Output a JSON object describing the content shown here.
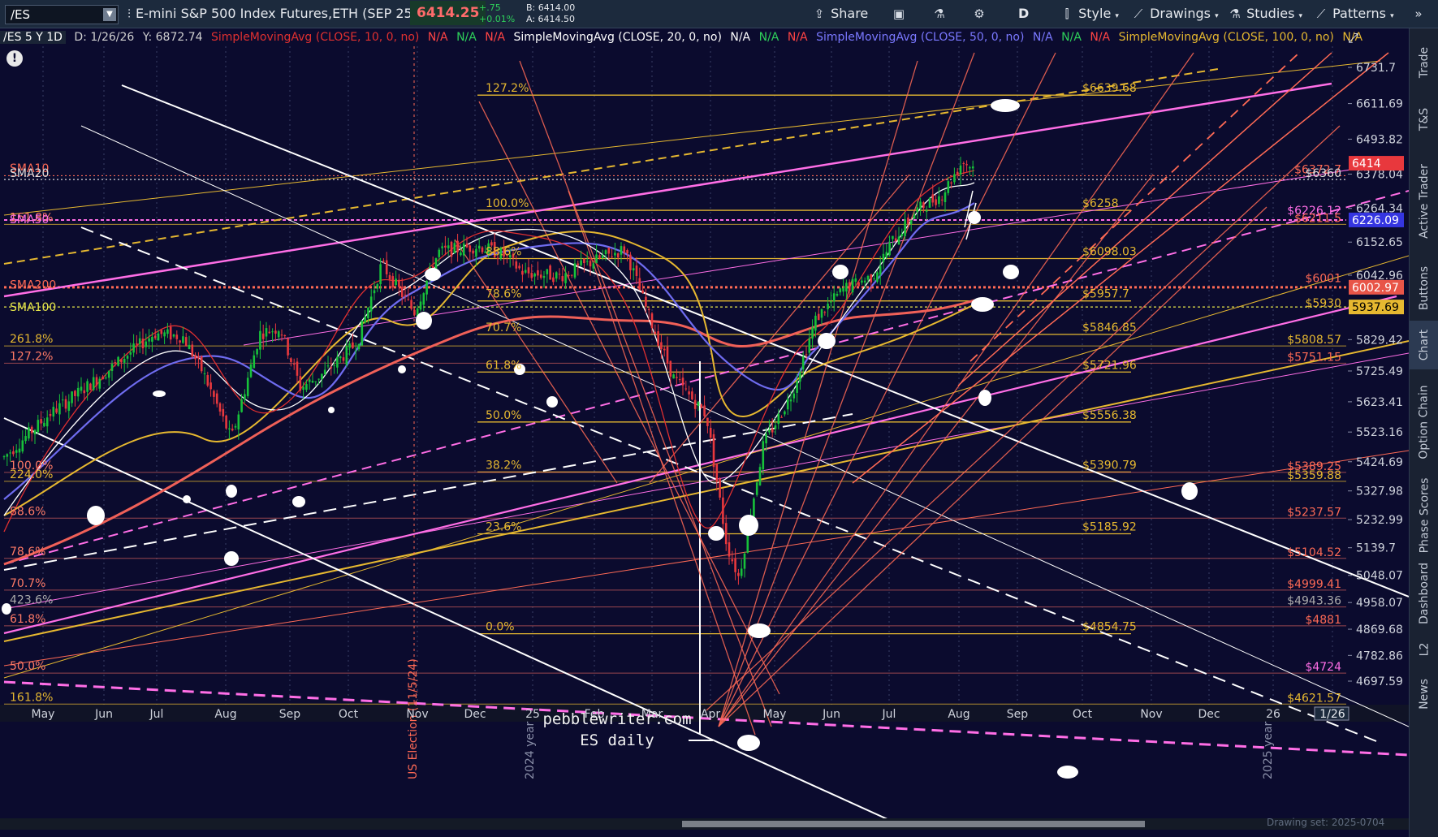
{
  "toolbar": {
    "symbol": "/ES",
    "description": "E-mini S&P 500 Index Futures,ETH (SEP 25)",
    "last": "6414.25",
    "change": "+.75",
    "change_pct": "+0.01%",
    "bid": "B: 6414.00",
    "ask": "A: 6414.50",
    "share_label": "Share",
    "timeframe": "D",
    "style_label": "Style",
    "drawings_label": "Drawings",
    "studies_label": "Studies",
    "patterns_label": "Patterns"
  },
  "studybar": {
    "head": "/ES 5 Y 1D",
    "cursor_date": "D: 1/26/26",
    "cursor_y": "Y: 6872.74",
    "sma10": "SimpleMovingAvg (CLOSE, 10, 0, no)",
    "sma20": "SimpleMovingAvg (CLOSE, 20, 0, no)",
    "sma50": "SimpleMovingAvg (CLOSE, 50, 0, no)",
    "sma100": "SimpleMovingAvg (CLOSE, 100, 0, no)",
    "na": "N/A"
  },
  "colors": {
    "background": "#0b0b2e",
    "up_candle": "#17c23a",
    "down_candle": "#e8383d",
    "sma10": "#e03030",
    "sma20": "#ffffff",
    "sma50": "#6f6cf0",
    "sma100": "#e0b62a",
    "sma200": "#f06058",
    "magenta": "#ff6ee6",
    "salmon": "#ff6a55",
    "gold": "#e6b830"
  },
  "price_axis": [
    "6731.7",
    "6611.69",
    "6493.82",
    "6378.04",
    "6264.34",
    "6152.65",
    "6042.96",
    "5937.69",
    "5829.42",
    "5725.49",
    "5623.41",
    "5523.16",
    "5424.69",
    "5327.98",
    "5232.99",
    "5139.7",
    "5048.07",
    "4958.07",
    "4869.68",
    "4782.86",
    "4697.59"
  ],
  "price_badges": [
    {
      "text": "6414",
      "price": 6414,
      "bg": "#e8383d",
      "fg": "#ffffff"
    },
    {
      "text": "6226.09",
      "price": 6226.09,
      "bg": "#3535e0",
      "fg": "#ffffff"
    },
    {
      "text": "6002.97",
      "price": 6002.97,
      "bg": "#e85548",
      "fg": "#ffffff"
    },
    {
      "text": "5937.69",
      "price": 5937.69,
      "bg": "#e6b830",
      "fg": "#000000"
    }
  ],
  "time_axis": [
    "May",
    "Jun",
    "Jul",
    "Aug",
    "Sep",
    "Oct",
    "Nov",
    "Dec",
    "25",
    "Feb",
    "Mar",
    "Apr",
    "May",
    "Jun",
    "Jul",
    "Aug",
    "Sep",
    "Oct",
    "Nov",
    "Dec",
    "26",
    "1/26"
  ],
  "fib_right": [
    {
      "text": "127.2%",
      "level": "$6639.68",
      "price": 6639.68
    },
    {
      "text": "100.0%",
      "level": "$6258",
      "price": 6258
    },
    {
      "text": "88.6%",
      "level": "$6098.03",
      "price": 6098.03
    },
    {
      "text": "78.6%",
      "level": "$5957.7",
      "price": 5957.7
    },
    {
      "text": "70.7%",
      "level": "$5846.85",
      "price": 5846.85
    },
    {
      "text": "61.8%",
      "level": "$5721.96",
      "price": 5721.96
    },
    {
      "text": "50.0%",
      "level": "$5556.38",
      "price": 5556.38
    },
    {
      "text": "38.2%",
      "level": "$5390.79",
      "price": 5390.79
    },
    {
      "text": "23.6%",
      "level": "$5185.92",
      "price": 5185.92
    },
    {
      "text": "0.0%",
      "level": "$4854.75",
      "price": 4854.75
    }
  ],
  "fib_left": [
    {
      "text": "161.8%",
      "price": 6211.5
    },
    {
      "text": "261.8%",
      "price": 5808.57
    },
    {
      "text": "127.2%",
      "price": 5751.15
    },
    {
      "text": "100.0%",
      "price": 5389.25
    },
    {
      "text": "224.0%",
      "price": 5359.88
    },
    {
      "text": "88.6%",
      "price": 5237.57
    },
    {
      "text": "78.6%",
      "price": 5104.52
    },
    {
      "text": "70.7%",
      "price": 4999.41
    },
    {
      "text": "423.6%",
      "price": 4943.36
    },
    {
      "text": "61.8%",
      "price": 4881
    },
    {
      "text": "50.0%",
      "price": 4724
    },
    {
      "text": "161.8%",
      "price": 4621.57
    }
  ],
  "right_levels": [
    {
      "text": "$6372.7",
      "price": 6372.7,
      "color": "#ff6a55"
    },
    {
      "text": "$6360",
      "price": 6360,
      "color": "#dddddd"
    },
    {
      "text": "$6226.12",
      "price": 6236,
      "color": "#ff6ee6"
    },
    {
      "text": "$6211.5",
      "price": 6211.5,
      "color": "#ff6a55"
    },
    {
      "text": "$6001",
      "price": 6012,
      "color": "#ff6a55"
    },
    {
      "text": "$5930",
      "price": 5930,
      "color": "#e6b830"
    },
    {
      "text": "$5808.57",
      "price": 5808.57,
      "color": "#e6b830"
    },
    {
      "text": "$5751.15",
      "price": 5751.15,
      "color": "#ff6a55"
    },
    {
      "text": "$5389.25",
      "price": 5389.25,
      "color": "#ff6a55"
    },
    {
      "text": "$5359.88",
      "price": 5359.88,
      "color": "#e6b830"
    },
    {
      "text": "$5237.57",
      "price": 5237.57,
      "color": "#ff6a55"
    },
    {
      "text": "$5104.52",
      "price": 5104.52,
      "color": "#ff6a55"
    },
    {
      "text": "$4999.41",
      "price": 4999.41,
      "color": "#ff6a55"
    },
    {
      "text": "$4943.36",
      "price": 4943.36,
      "color": "#aaaaaa"
    },
    {
      "text": "$4881",
      "price": 4881,
      "color": "#ff6a55"
    },
    {
      "text": "$4724",
      "price": 4724,
      "color": "#ff6ee6"
    },
    {
      "text": "$4621.57",
      "price": 4621.57,
      "color": "#e6b830"
    }
  ],
  "sma_labels": [
    {
      "text": "SMA10",
      "price": 6398,
      "color": "#ff6a55"
    },
    {
      "text": "SMA20",
      "price": 6382,
      "color": "#dddddd"
    },
    {
      "text": "SMA50",
      "price": 6228,
      "color": "#ff6ee6"
    },
    {
      "text": "SMA200",
      "price": 6012,
      "color": "#ff6a55"
    },
    {
      "text": "SMA100",
      "price": 5938,
      "color": "#e6e64a"
    }
  ],
  "annotations": {
    "election": "US Election (11/5/24)",
    "year_2024": "2024 year",
    "year_2025": "2025 year",
    "watermark_line1": "pebblewriter.com",
    "watermark_line2": "ES daily",
    "drawing_set": "Drawing set: 2025-0704"
  },
  "right_tabs": [
    "Trade",
    "T&S",
    "Active Trader",
    "Buttons",
    "Chart",
    "Option Chain",
    "Phase Scores",
    "Dashboard",
    "L2",
    "News"
  ]
}
